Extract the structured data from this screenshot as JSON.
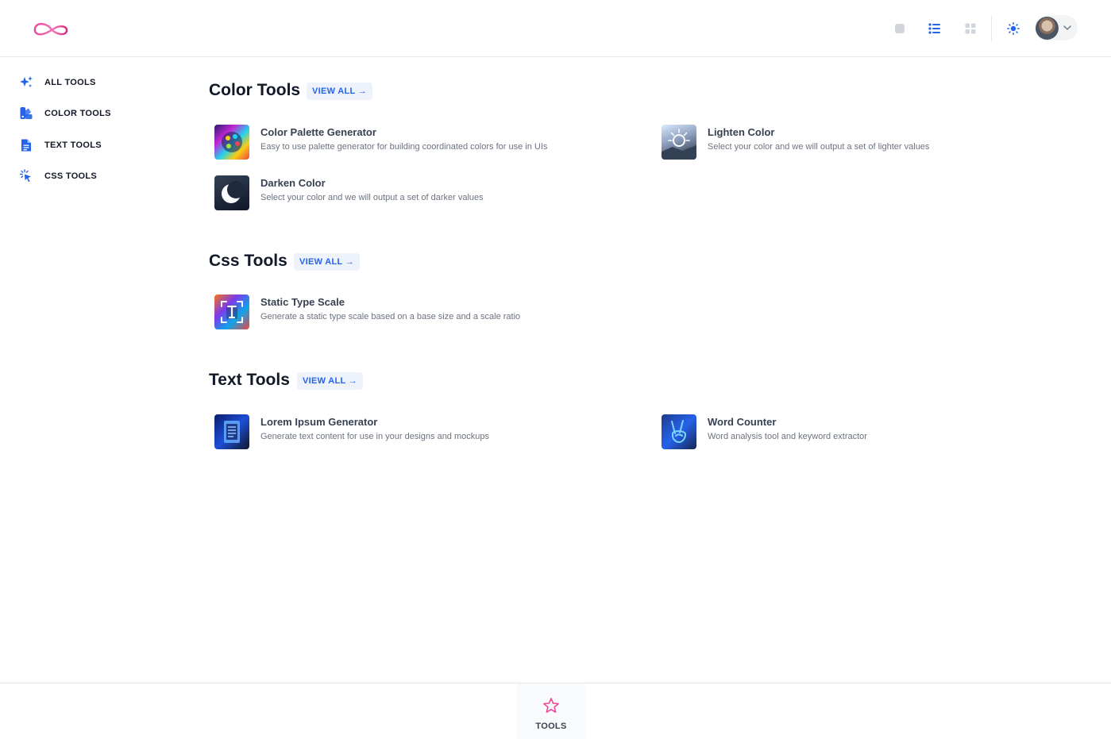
{
  "header": {
    "logo_icon": "infinity-logo-icon",
    "buttons": [
      {
        "name": "single-view-icon",
        "color": "#d1d5db"
      },
      {
        "name": "list-view-icon",
        "color": "#2563eb"
      },
      {
        "name": "grid-view-icon",
        "color": "#d1d5db"
      },
      {
        "name": "theme-sun-icon",
        "color": "#2563eb"
      }
    ]
  },
  "sidebar": {
    "items": [
      {
        "label": "ALL TOOLS",
        "icon": "sparkles-icon"
      },
      {
        "label": "COLOR TOOLS",
        "icon": "swatch-icon"
      },
      {
        "label": "TEXT TOOLS",
        "icon": "document-icon"
      },
      {
        "label": "CSS TOOLS",
        "icon": "cursor-click-icon"
      }
    ]
  },
  "sections": [
    {
      "title": "Color Tools",
      "view_all": "VIEW ALL →",
      "tools": [
        {
          "name": "Color Palette Generator",
          "desc": "Easy to use palette generator for building coordinated colors for use in UIs"
        },
        {
          "name": "Lighten Color",
          "desc": "Select your color and we will output a set of lighter values"
        },
        {
          "name": "Darken Color",
          "desc": "Select your color and we will output a set of darker values"
        }
      ]
    },
    {
      "title": "Css Tools",
      "view_all": "VIEW ALL →",
      "tools": [
        {
          "name": "Static Type Scale",
          "desc": "Generate a static type scale based on a base size and a scale ratio"
        }
      ]
    },
    {
      "title": "Text Tools",
      "view_all": "VIEW ALL →",
      "tools": [
        {
          "name": "Lorem Ipsum Generator",
          "desc": "Generate text content for use in your designs and mockups"
        },
        {
          "name": "Word Counter",
          "desc": "Word analysis tool and keyword extractor"
        }
      ]
    }
  ],
  "bottom_nav": {
    "tab_label": "TOOLS",
    "tab_icon": "star-icon",
    "accent": "#ec4899"
  },
  "colors": {
    "brand_blue": "#2563eb",
    "logo_gradient": [
      "#ec4899",
      "#f97316"
    ]
  }
}
